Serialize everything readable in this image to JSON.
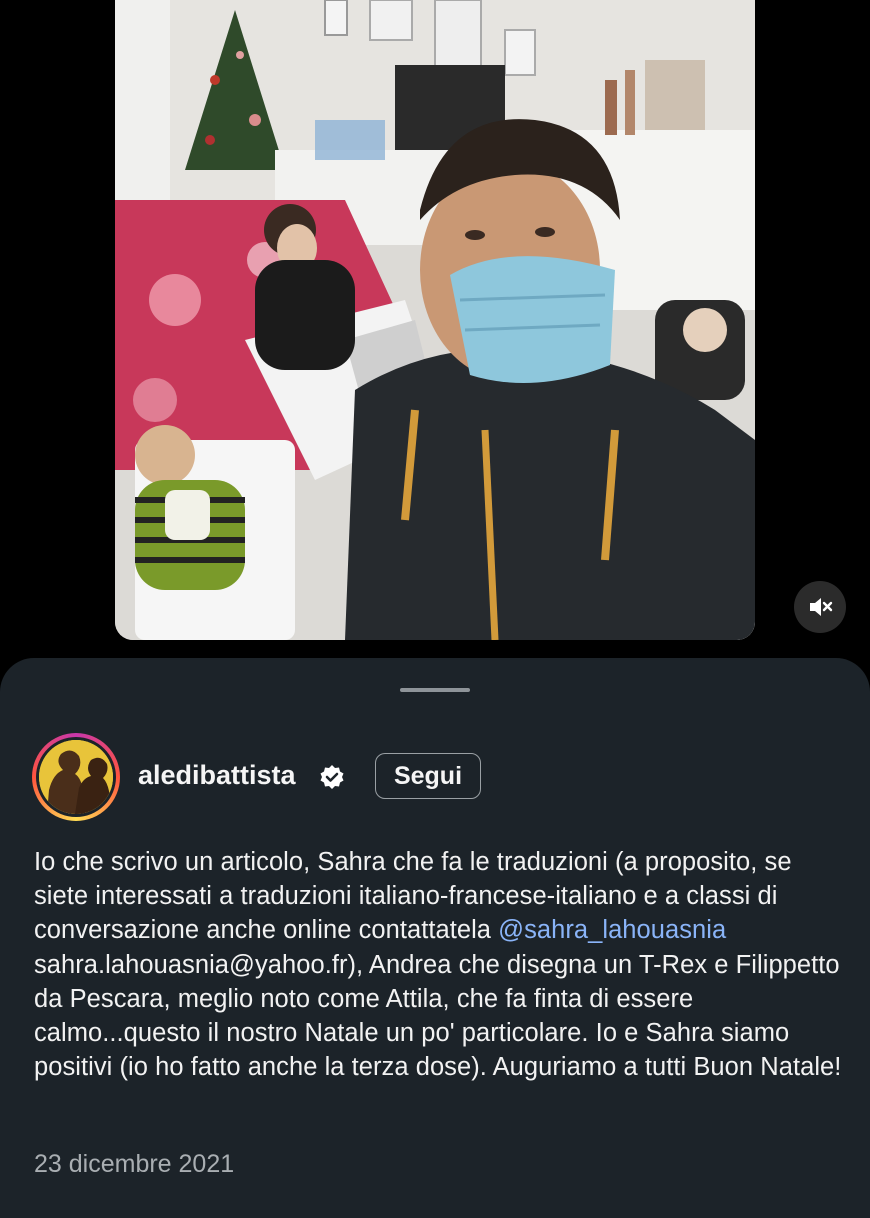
{
  "post": {
    "username": "aledibattista",
    "follow_label": "Segui",
    "caption": {
      "part1": "Io che scrivo un articolo, Sahra che fa le traduzioni (a proposito, se siete interessati a traduzioni italiano-francese-italiano e a classi di conversazione anche online contattatela ",
      "mention": "@sahra_lahouasnia",
      "part2": " sahra.lahouasnia@yahoo.fr), Andrea che disegna un T-Rex e Filippetto da Pescara, meglio noto come Attila, che fa finta di essere calmo...questo il nostro Natale un po' particolare. Io e Sahra siamo positivi (io ho fatto anche la terza dose). Auguriamo a tutti Buon Natale!"
    },
    "date": "23 dicembre 2021"
  },
  "icons": {
    "mute": "speaker-muted-icon",
    "verified": "verified-badge-icon"
  },
  "colors": {
    "sheet_background": "#1c2329",
    "mention": "#8ab4f8",
    "verified_badge": "#ffffff"
  }
}
